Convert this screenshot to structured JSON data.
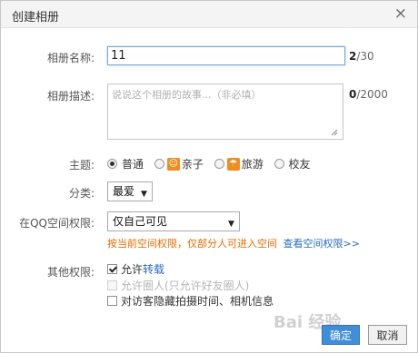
{
  "dialog": {
    "title": "创建相册",
    "close_glyph": "×"
  },
  "form": {
    "name": {
      "label": "相册名称:",
      "value": "11",
      "count": "2",
      "max": "/30"
    },
    "description": {
      "label": "相册描述:",
      "placeholder": "说说这个相册的故事...（非必填）",
      "count": "0",
      "max": "/2000"
    },
    "theme": {
      "label": "主题:",
      "options": [
        {
          "label": "普通",
          "checked": true,
          "icon": ""
        },
        {
          "label": "亲子",
          "checked": false,
          "icon": "child-icon"
        },
        {
          "label": "旅游",
          "checked": false,
          "icon": "umbrella-icon"
        },
        {
          "label": "校友",
          "checked": false,
          "icon": ""
        }
      ]
    },
    "category": {
      "label": "分类:",
      "value": "最爱"
    },
    "permission": {
      "label": "在QQ空间权限:",
      "value": "仅自己可见",
      "hint": "按当前空间权限，仅部分人可进入空间",
      "hint_link": "查看空间权限>>"
    },
    "other": {
      "label": "其他权限:",
      "allow_repost": {
        "prefix": "允许",
        "link": "转载",
        "checked": true
      },
      "allow_circle": {
        "label": "允许圈人(只允许好友圈人)",
        "checked": false,
        "disabled": true
      },
      "hide_info": {
        "label": "对访客隐藏拍摄时间、相机信息",
        "checked": false
      }
    }
  },
  "buttons": {
    "ok": "确定",
    "cancel": "取消"
  },
  "watermark": "Bai 经验",
  "colors": {
    "accent": "#3f8ed8",
    "hint_orange": "#e66c00",
    "link_blue": "#2a6cbc",
    "theme_icon": "#f28c1f"
  }
}
